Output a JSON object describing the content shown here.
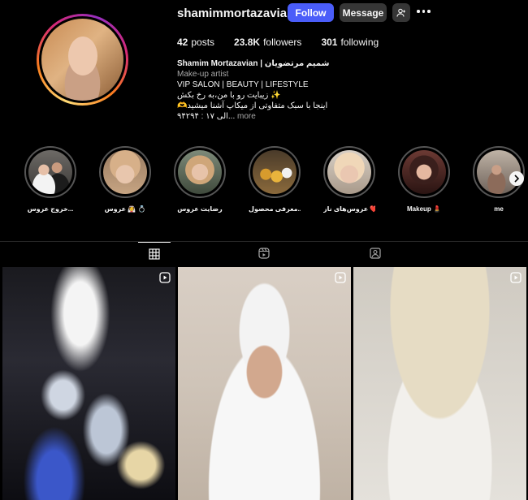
{
  "profile": {
    "username": "shamimmortazavian",
    "follow_label": "Follow",
    "message_label": "Message",
    "posts_count": "42",
    "posts_label": "posts",
    "followers_count": "23.8K",
    "followers_label": "followers",
    "following_count": "301",
    "following_label": "following",
    "display_name": "Shamim Mortazavian | شمیم مرتضویان",
    "category": "Make-up artist",
    "bio_line1": "VIP SALON | BEAUTY | LIFESTYLE",
    "bio_line2": "✨ زیبایت رو با من،به رخ بکش",
    "bio_line3": "اینجا با سبک متفاوتی از میکاپ آشنا میشید🫶",
    "bio_line4": "...الی ۱۷ : ۹۴۲۹۴",
    "more_label": "more"
  },
  "highlights": [
    {
      "label": "خروج عروس..."
    },
    {
      "label": "عروس 👰 💍"
    },
    {
      "label": "رضایت عروس"
    },
    {
      "label": "معرفی محصول..."
    },
    {
      "label": "عروس‌های ناز ❤️"
    },
    {
      "label": "Makeup 💄"
    },
    {
      "label": "me"
    }
  ],
  "icons": {
    "add_user": "add-user-icon",
    "more": "more-horizontal-icon",
    "grid_tab": "grid-icon",
    "reels_tab": "reels-icon",
    "tagged_tab": "tagged-icon",
    "reel_badge": "reel-icon",
    "next": "chevron-right-icon"
  },
  "colors": {
    "follow_button": "#4a5df9",
    "secondary_button": "#363636",
    "background": "#000000"
  }
}
